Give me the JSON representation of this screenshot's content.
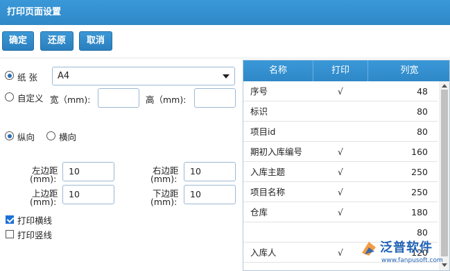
{
  "window": {
    "title": "打印页面设置"
  },
  "toolbar": {
    "confirm": "确定",
    "restore": "还原",
    "cancel": "取消"
  },
  "paper": {
    "mode_paper_label": "纸 张",
    "paper_size": "A4",
    "mode_custom_label": "自定义",
    "width_label": "宽（mm):",
    "height_label": "高（mm):",
    "width_value": "",
    "height_value": "",
    "selected_mode": "paper"
  },
  "orientation": {
    "portrait": "纵向",
    "landscape": "横向",
    "selected": "portrait"
  },
  "margins": {
    "left_label_1": "左边距",
    "left_label_2": "(mm):",
    "left_value": "10",
    "right_label_1": "右边距",
    "right_label_2": "(mm):",
    "right_value": "10",
    "top_label_1": "上边距",
    "top_label_2": "(mm):",
    "top_value": "10",
    "bottom_label_1": "下边距",
    "bottom_label_2": "(mm):",
    "bottom_value": "10"
  },
  "options": {
    "horizontal_lines": {
      "label": "打印横线",
      "checked": true
    },
    "vertical_lines": {
      "label": "打印竖线",
      "checked": false
    }
  },
  "grid": {
    "headers": [
      "名称",
      "打印",
      "列宽"
    ],
    "rows": [
      {
        "name": "序号",
        "print": "√",
        "width": "48"
      },
      {
        "name": "标识",
        "print": "",
        "width": "80"
      },
      {
        "name": "项目id",
        "print": "",
        "width": "80"
      },
      {
        "name": "期初入库编号",
        "print": "√",
        "width": "160"
      },
      {
        "name": "入库主题",
        "print": "√",
        "width": "250"
      },
      {
        "name": "项目名称",
        "print": "√",
        "width": "250"
      },
      {
        "name": "仓库",
        "print": "√",
        "width": "180"
      },
      {
        "name": "",
        "print": "",
        "width": "80"
      },
      {
        "name": "入库人",
        "print": "√",
        "width": "120"
      }
    ]
  },
  "watermark": {
    "brand": "泛普软件",
    "url": "www.fanpusoft.com"
  },
  "colors": {
    "header_blue": "#2f88c7",
    "button_blue": "#2b7fbe",
    "check_blue": "#1d6fd6"
  }
}
